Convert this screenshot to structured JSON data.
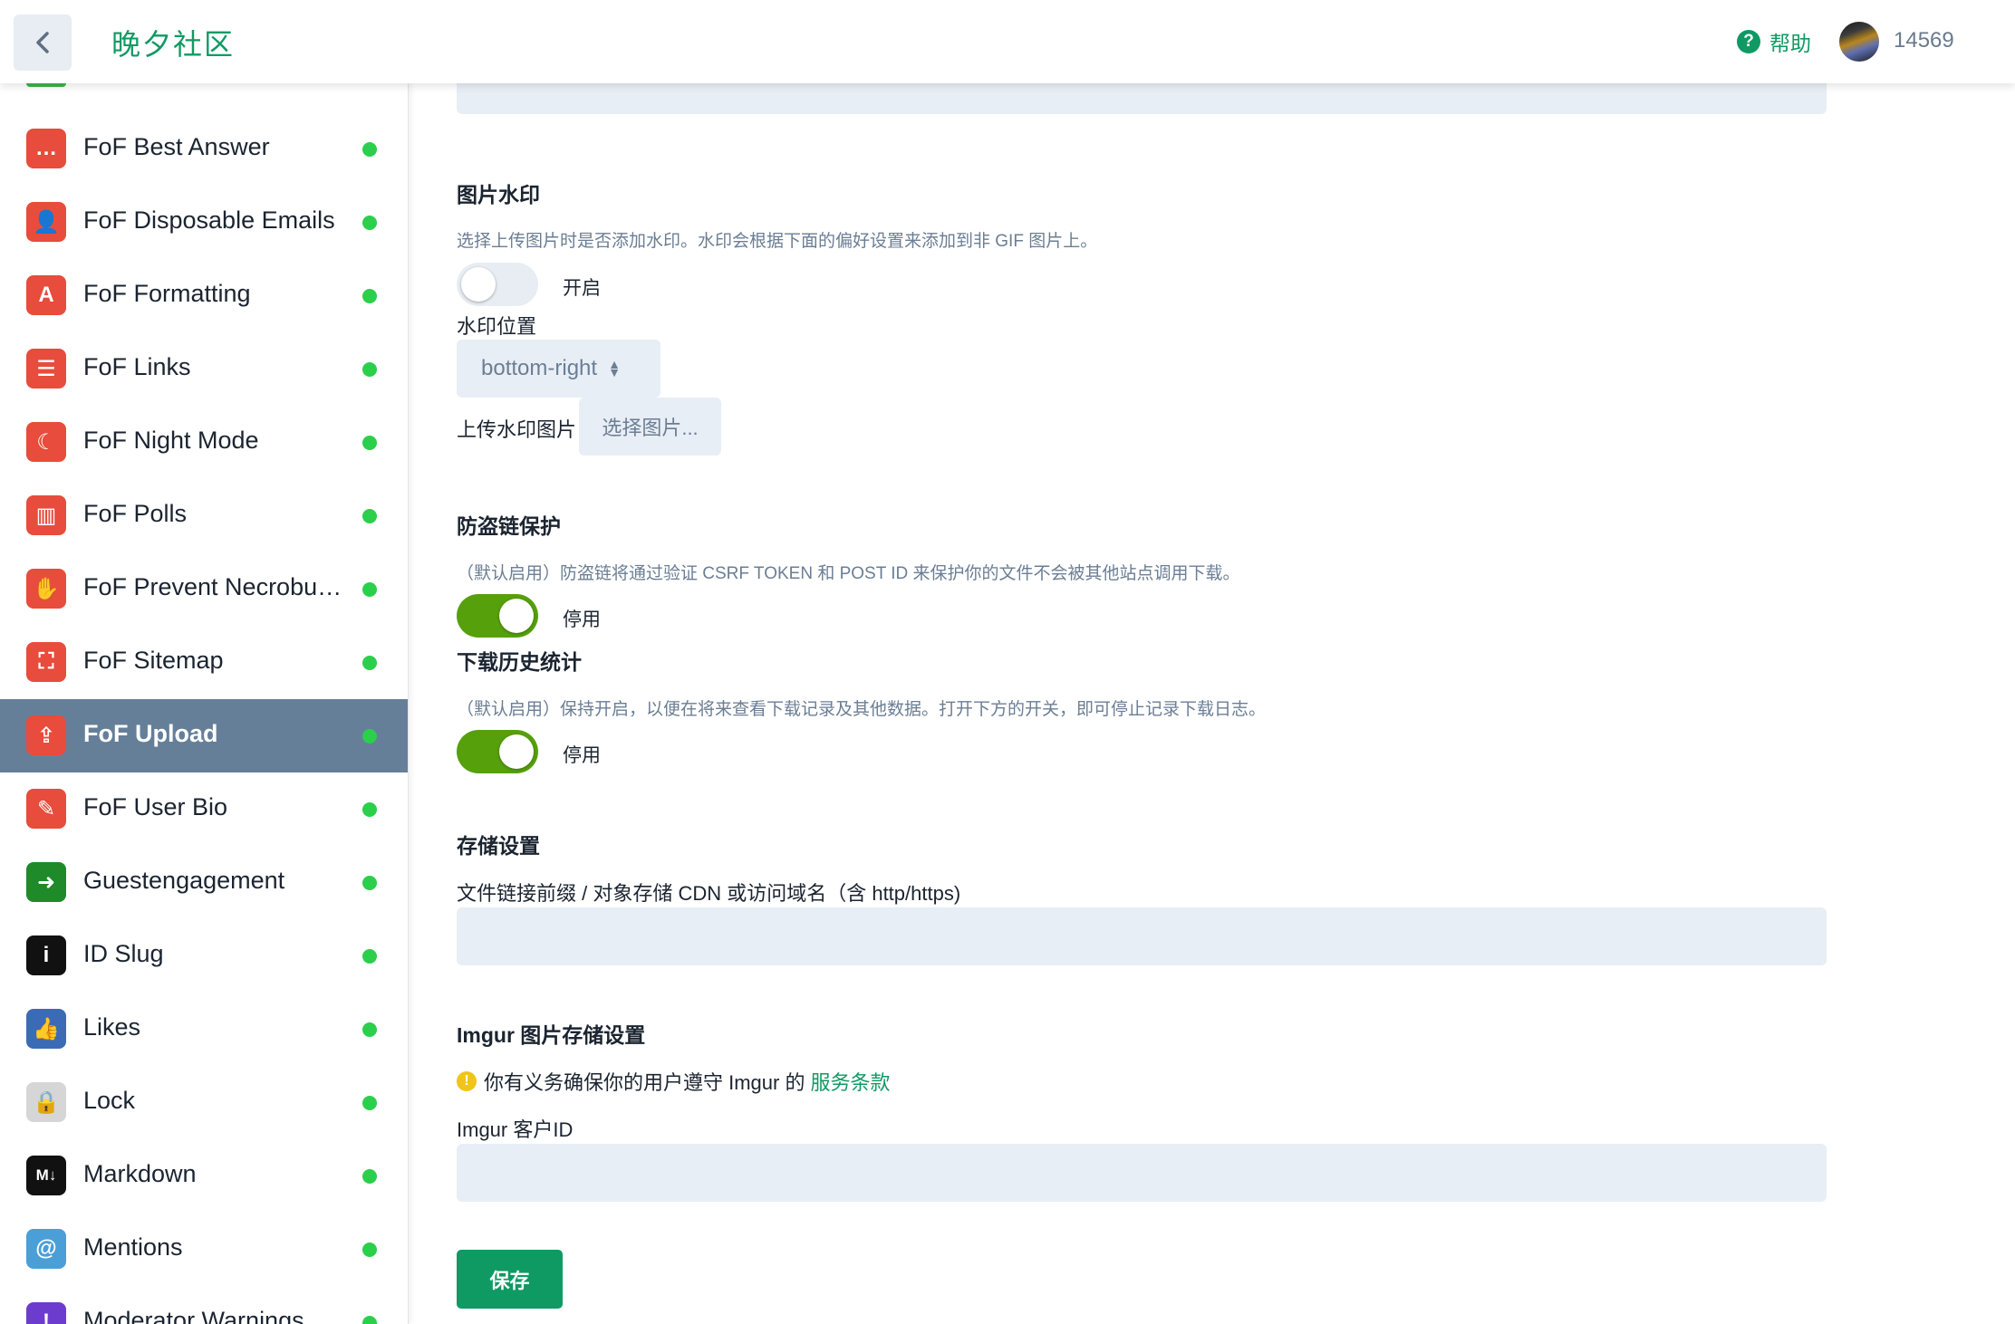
{
  "header": {
    "site_title": "晚夕社区",
    "help_label": "帮助",
    "username": "14569"
  },
  "sidebar": {
    "items": [
      {
        "label": "FoF Best Answer",
        "icon": "comment-dots-icon",
        "color": "#e74c3c",
        "status": "enabled"
      },
      {
        "label": "FoF Disposable Emails",
        "icon": "user-times-icon",
        "color": "#e74c3c",
        "status": "enabled"
      },
      {
        "label": "FoF Formatting",
        "icon": "letter-a-icon",
        "color": "#e74c3c",
        "status": "enabled"
      },
      {
        "label": "FoF Links",
        "icon": "bars-icon",
        "color": "#e74c3c",
        "status": "enabled"
      },
      {
        "label": "FoF Night Mode",
        "icon": "moon-icon",
        "color": "#e74c3c",
        "status": "enabled"
      },
      {
        "label": "FoF Polls",
        "icon": "poll-chart-icon",
        "color": "#e74c3c",
        "status": "enabled"
      },
      {
        "label": "FoF Prevent Necrobumping",
        "icon": "hand-icon",
        "color": "#e74c3c",
        "status": "enabled"
      },
      {
        "label": "FoF Sitemap",
        "icon": "sitemap-icon",
        "color": "#e74c3c",
        "status": "enabled"
      },
      {
        "label": "FoF Upload",
        "icon": "file-upload-icon",
        "color": "#e74c3c",
        "status": "enabled",
        "active": true
      },
      {
        "label": "FoF User Bio",
        "icon": "pencil-icon",
        "color": "#e74c3c",
        "status": "enabled"
      },
      {
        "label": "Guestengagement",
        "icon": "sign-in-icon",
        "color": "#1e8a2a",
        "status": "enabled"
      },
      {
        "label": "ID Slug",
        "icon": "info-icon",
        "color": "#111111",
        "status": "enabled"
      },
      {
        "label": "Likes",
        "icon": "thumbs-up-icon",
        "color": "#3b6bb5",
        "status": "enabled"
      },
      {
        "label": "Lock",
        "icon": "lock-icon",
        "color": "#d6d6d6",
        "status": "enabled"
      },
      {
        "label": "Markdown",
        "icon": "markdown-icon",
        "color": "#111111",
        "status": "enabled"
      },
      {
        "label": "Mentions",
        "icon": "at-icon",
        "color": "#4a9fd8",
        "status": "enabled"
      },
      {
        "label": "Moderator Warnings",
        "icon": "exclamation-icon",
        "color": "#6c3ccf",
        "status": "enabled"
      }
    ]
  },
  "watermark": {
    "title": "图片水印",
    "help": "选择上传图片时是否添加水印。水印会根据下面的偏好设置来添加到非 GIF 图片上。",
    "toggle_label": "开启",
    "toggle_on": false,
    "position_label": "水印位置",
    "position_value": "bottom-right",
    "upload_label": "上传水印图片",
    "choose_image": "选择图片..."
  },
  "hotlink": {
    "title": "防盗链保护",
    "help": "（默认启用）防盗链将通过验证 CSRF TOKEN 和 POST ID 来保护你的文件不会被其他站点调用下载。",
    "toggle_label": "停用",
    "toggle_on": true
  },
  "download_stats": {
    "title": "下载历史统计",
    "help": "（默认启用）保持开启，以便在将来查看下载记录及其他数据。打开下方的开关，即可停止记录下载日志。",
    "toggle_label": "停用",
    "toggle_on": true
  },
  "storage": {
    "title": "存储设置",
    "cdn_label": "文件链接前缀 / 对象存储 CDN 或访问域名（含 http/https)",
    "cdn_value": ""
  },
  "imgur": {
    "title": "Imgur 图片存储设置",
    "notice": "你有义务确保你的用户遵守 Imgur 的",
    "tos_link": "服务条款",
    "client_id_label": "Imgur 客户ID",
    "client_id_value": ""
  },
  "save_label": "保存",
  "colors": {
    "accent": "#0f9a63",
    "toggle_on": "#56a00c",
    "status_dot": "#2bcf4b",
    "active_item_bg": "#667f99"
  }
}
